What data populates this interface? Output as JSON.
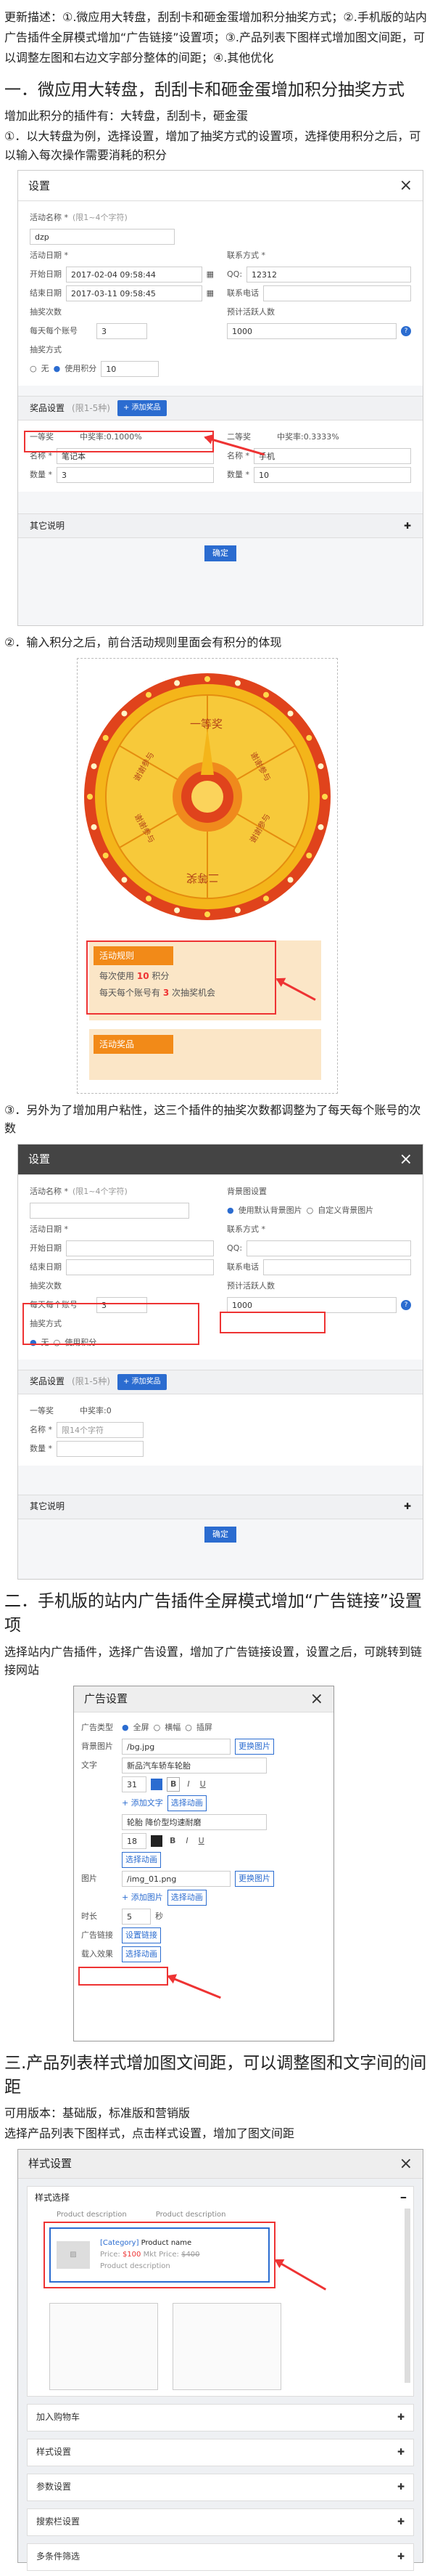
{
  "intro": {
    "para1": "更新描述：①.微应用大转盘，刮刮卡和砸金蛋增加积分抽奖方式；②.手机版的站内广告插件全屏模式增加“广告链接”设置项；③.产品列表下图样式增加图文间距，可以调整左图和右边文字部分整体的间距；④.其他优化"
  },
  "sec1": {
    "heading": "一．微应用大转盘，刮刮卡和砸金蛋增加积分抽奖方式",
    "p1": "增加此积分的插件有：大转盘，刮刮卡，砸金蛋",
    "p2": "①．以大转盘为例，选择设置，增加了抽奖方式的设置项，选择使用积分之后，可以输入每次操作需要消耗的积分",
    "p3": "②．输入积分之后，前台活动规则里面会有积分的体现",
    "p4": "③．另外为了增加用户粘性，这三个插件的抽奖次数都调整为了每天每个账号的次数"
  },
  "dialog1": {
    "title": "设置",
    "activity_name_label": "活动名称 *",
    "activity_name_hint": "(限1~4个字符)",
    "activity_name_value": "dzp",
    "activity_date_label": "活动日期 *",
    "start_label": "开始日期",
    "start_value": "2017-02-04 09:58:44",
    "end_label": "结束日期",
    "end_value": "2017-03-11 09:58:45",
    "draw_times_label": "抽奖次数",
    "per_account_label": "每天每个账号",
    "per_account_value": "3",
    "draw_method_label": "抽奖方式",
    "radio_none": "无",
    "radio_points": "使用积分",
    "points_value": "10",
    "contact_label": "联系方式 *",
    "qq_label": "QQ:",
    "qq_value": "12312",
    "contact_phone_label": "联系电话",
    "expected_label": "预计活跃人数",
    "expected_value": "1000",
    "prize_label": "奖品设置",
    "prize_hint": "(限1-5种)",
    "add_prize": "+ 添加奖品",
    "prize1_level": "一等奖",
    "prize1_rate": "中奖率:0.1000%",
    "prize1_name_label": "名称 *",
    "prize1_name": "笔记本",
    "prize1_qty_label": "数量 *",
    "prize1_qty": "3",
    "prize2_level": "二等奖",
    "prize2_rate": "中奖率:0.3333%",
    "prize2_name_label": "名称 *",
    "prize2_name": "手机",
    "prize2_qty_label": "数量 *",
    "prize2_qty": "10",
    "other_label": "其它说明",
    "ok": "确定"
  },
  "wheel": {
    "seg_top": "一等奖",
    "seg_bottom": "二等奖",
    "seg_left_up": "谢谢参与",
    "seg_right_up": "谢谢参与",
    "seg_left_down": "谢谢参与",
    "seg_right_down": "谢谢参与",
    "rules_title": "活动规则",
    "rule1_a": "每次使用",
    "rule1_num": "10",
    "rule1_b": "积分",
    "rule2_a": "每天每个账号有",
    "rule2_num": "3",
    "rule2_b": "次抽奖机会",
    "prize_title": "活动奖品"
  },
  "dialog2": {
    "title": "设置",
    "activity_name_label": "活动名称 *",
    "activity_name_hint": "(限1~4个字符)",
    "bg_label": "背景图设置",
    "bg_opt1": "使用默认背景图片",
    "bg_opt2": "自定义背景图片",
    "activity_date_label": "活动日期 *",
    "start_label": "开始日期",
    "end_label": "结束日期",
    "contact_label": "联系方式 *",
    "qq_label": "QQ:",
    "contact_phone_label": "联系电话",
    "draw_times_label": "抽奖次数",
    "per_account_label": "每天每个账号",
    "per_account_value": "3",
    "draw_method_label": "抽奖方式",
    "radio_none": "无",
    "radio_points": "使用积分",
    "expected_label": "预计活跃人数",
    "expected_value": "1000",
    "prize_label": "奖品设置",
    "prize_hint": "(限1-5种)",
    "add_prize": "+ 添加奖品",
    "prize1_level": "一等奖",
    "prize1_rate": "中奖率:0",
    "prize1_name_label": "名称 *",
    "prize1_name_placeholder": "限14个字符",
    "prize1_qty_label": "数量 *",
    "other_label": "其它说明",
    "ok": "确定"
  },
  "sec2": {
    "heading": "二．手机版的站内广告插件全屏模式增加“广告链接”设置项",
    "p1": "选择站内广告插件，选择广告设置，增加了广告链接设置，设置之后，可跳转到链接网站"
  },
  "ad_dialog": {
    "title": "广告设置",
    "type_label": "广告类型",
    "type_full": "全屏",
    "type_h": "横幅",
    "type_float": "插屏",
    "bg_label": "背景图片",
    "bg_value": "/bg.jpg",
    "change_bg": "更换图片",
    "text_label": "文字",
    "text1": "新品汽车轿车轮胎",
    "font1": "31",
    "add_text": "+ 添加文字",
    "anim1": "选择动画",
    "text2": "轮胎 降价型均速耐磨",
    "font2": "18",
    "anim2": "选择动画",
    "img_label": "图片",
    "img_value": "/img_01.png",
    "change_img": "更换图片",
    "add_img": "+ 添加图片",
    "anim3": "选择动画",
    "duration_label": "时长",
    "duration_value": "5",
    "duration_unit": "秒",
    "link_label": "广告链接",
    "link_btn": "设置链接",
    "enter_label": "载入效果",
    "enter_btn": "选择动画"
  },
  "sec3": {
    "heading": "三.产品列表样式增加图文间距，可以调整图和文字间的间距",
    "p1": "可用版本：基础版，标准版和营销版",
    "p2": "选择产品列表下图样式，点击样式设置，增加了图文间距"
  },
  "style_dialog": {
    "title": "样式设置",
    "section": "样式选择",
    "prod_desc": "Product description",
    "category": "[Category]",
    "prod_name": "Product name",
    "price_label": "Price:",
    "price": "$100",
    "mkt_label": "Mkt Price:",
    "mkt_price": "$400",
    "acc1": "加入购物车",
    "acc2": "样式设置",
    "acc3": "参数设置",
    "acc4": "搜索栏设置",
    "acc5": "多条件筛选"
  }
}
